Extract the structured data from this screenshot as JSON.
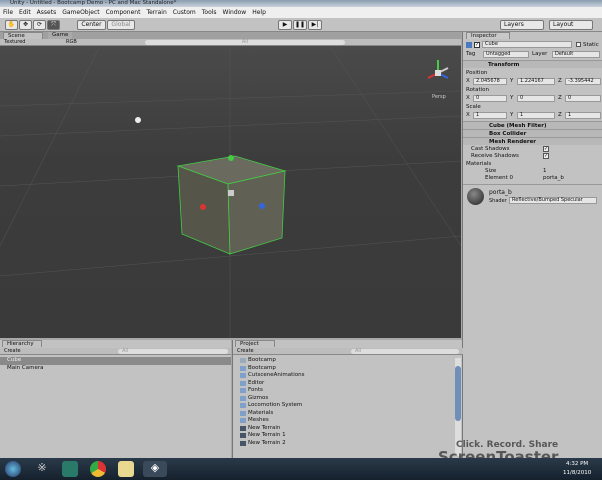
{
  "title": "Unity - Untitled - Bootcamp Demo - PC and Mac Standalone*",
  "menu": [
    "File",
    "Edit",
    "Assets",
    "GameObject",
    "Component",
    "Terrain",
    "Custom",
    "Tools",
    "Window",
    "Help"
  ],
  "toolbar": {
    "center": "Center",
    "global": "Global",
    "layers": "Layers",
    "layout": "Layout"
  },
  "scene": {
    "tab_scene": "Scene",
    "tab_game": "Game",
    "render_mode": "Textured",
    "color_mode": "RGB",
    "search_placeholder": "All",
    "persp": "Persp"
  },
  "inspector": {
    "tab": "Inspector",
    "object_name": "Cube",
    "static_label": "Static",
    "tag_label": "Tag",
    "tag_value": "Untagged",
    "layer_label": "Layer",
    "layer_value": "Default",
    "transform": "Transform",
    "position": "Position",
    "rotation": "Rotation",
    "scale": "Scale",
    "pos": {
      "x": "2.045678",
      "y": "1.224167",
      "z": "-3.395442"
    },
    "rot": {
      "x": "0",
      "y": "0",
      "z": "0"
    },
    "scl": {
      "x": "1",
      "y": "1",
      "z": "1"
    },
    "axis": {
      "x": "X",
      "y": "Y",
      "z": "Z"
    },
    "mesh_filter": "Cube (Mesh Filter)",
    "box_collider": "Box Collider",
    "mesh_renderer": "Mesh Renderer",
    "cast_shadows": "Cast Shadows",
    "receive_shadows": "Receive Shadows",
    "materials": "Materials",
    "size_label": "Size",
    "size_value": "1",
    "element0_label": "Element 0",
    "element0_value": "porta_b",
    "material_name": "porta_b",
    "shader_label": "Shader",
    "shader_value": "Reflective/Bumped Specular"
  },
  "hierarchy": {
    "tab": "Hierarchy",
    "create": "Create",
    "search_placeholder": "All",
    "items": [
      "Cube",
      "Main Camera"
    ]
  },
  "project": {
    "tab": "Project",
    "create": "Create",
    "search_placeholder": "All",
    "items": [
      "Bootcamp",
      "Bootcamp",
      "CutsceneAnimations",
      "Editor",
      "Fonts",
      "Gizmos",
      "Locomotion System",
      "Materials",
      "Meshes",
      "New Terrain",
      "New Terrain 1",
      "New Terrain 2"
    ]
  },
  "watermark": {
    "line1": "Click. Record. Share",
    "line2": "ScreenToaster"
  },
  "clock": {
    "time": "4:32 PM",
    "date": "11/8/2010"
  }
}
